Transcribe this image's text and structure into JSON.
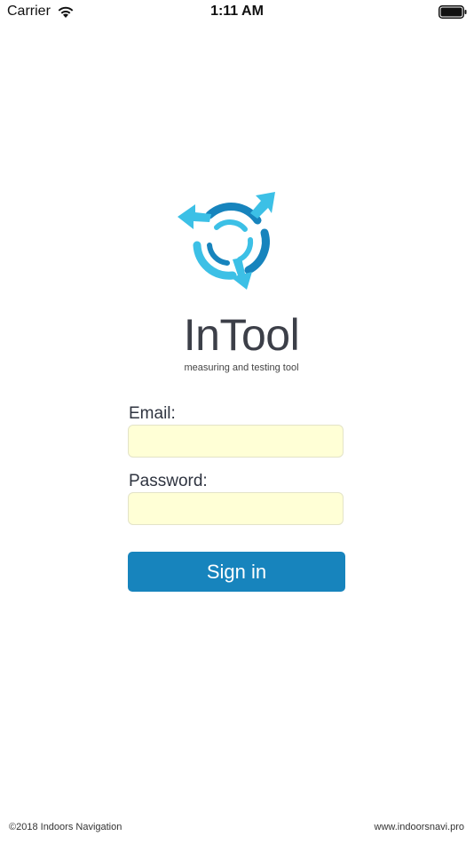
{
  "status_bar": {
    "carrier": "Carrier",
    "time": "1:11 AM"
  },
  "icons": {
    "wifi": "wifi-icon",
    "battery": "battery-icon",
    "logo": "intool-logo-icon"
  },
  "app": {
    "title": "InTool",
    "subtitle": "measuring and testing tool"
  },
  "form": {
    "email_label": "Email:",
    "email_value": "",
    "password_label": "Password:",
    "password_value": "",
    "sign_in_label": "Sign in"
  },
  "footer": {
    "copyright": "©2018 Indoors Navigation",
    "website": "www.indoorsnavi.pro"
  },
  "colors": {
    "accent": "#1784bd",
    "input_background": "#ffffd6",
    "logo_light": "#3cc0e6",
    "logo_dark": "#1784bd"
  }
}
